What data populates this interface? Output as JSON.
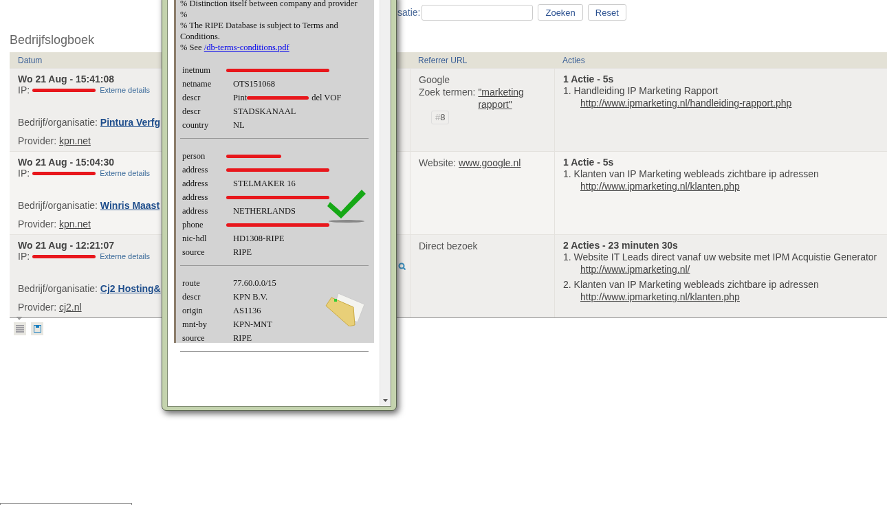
{
  "search": {
    "label": "satie:",
    "buttons": [
      "Zoeken",
      "Reset"
    ]
  },
  "title": "Bedrijfslogboek",
  "table": {
    "columns": [
      "Datum",
      "Referrer URL",
      "Acties"
    ],
    "rows": [
      {
        "date": "Wo 21 Aug - 15:41:08",
        "ip_label": "IP:",
        "external": "Externe details",
        "company_label": "Bedrijf/organisatie:",
        "company": "Pintura Verfg",
        "provider_label": "Provider:",
        "provider": "kpn.net",
        "zoom_icon": false,
        "referrer": {
          "kind": "search",
          "source": "Google",
          "terms_label": "Zoek termen:",
          "terms": "\"marketing rapport\"",
          "hash": "#",
          "count": "8"
        },
        "actions": {
          "summary": "1 Actie - 5s",
          "items": [
            {
              "number": "1.",
              "title": "Handleiding IP Marketing Rapport",
              "url": "http://www.ipmarketing.nl/handleiding-rapport.php"
            }
          ]
        }
      },
      {
        "date": "Wo 21 Aug - 15:04:30",
        "ip_label": "IP:",
        "external": "Externe details",
        "company_label": "Bedrijf/organisatie:",
        "company": "Winris Maast",
        "provider_label": "Provider:",
        "provider": "kpn.net",
        "zoom_icon": false,
        "referrer": {
          "kind": "website",
          "label": "Website:",
          "url": "www.google.nl"
        },
        "actions": {
          "summary": "1 Actie - 5s",
          "items": [
            {
              "number": "1.",
              "title": "Klanten van IP Marketing webleads zichtbare ip adressen",
              "url": "http://www.ipmarketing.nl/klanten.php"
            }
          ]
        }
      },
      {
        "date": "Wo 21 Aug - 12:21:07",
        "ip_label": "IP:",
        "external": "Externe details",
        "company_label": "Bedrijf/organisatie:",
        "company": "Cj2 Hosting&",
        "provider_label": "Provider:",
        "provider": "cj2.nl",
        "zoom_icon": true,
        "referrer": {
          "kind": "direct",
          "text": "Direct bezoek"
        },
        "actions": {
          "summary": "2 Acties - 23 minuten 30s",
          "items": [
            {
              "number": "1.",
              "title": "Website IT Leads direct vanaf uw website met IPM Acquistie Generator",
              "url": "http://www.ipmarketing.nl/"
            },
            {
              "number": "2.",
              "title": "Klanten van IP Marketing webleads zichtbare ip adressen",
              "url": "http://www.ipmarketing.nl/klanten.php"
            }
          ]
        }
      }
    ]
  },
  "whois_popup": {
    "notice": [
      "% Distinction itself between company and provider",
      "%",
      "% The RIPE Database is subject to Terms and Conditions."
    ],
    "see_prefix": "% See",
    "see_link": "/db-terms-conditions.pdf",
    "sections": [
      {
        "fields": [
          {
            "key": "inetnum",
            "redacted": true
          },
          {
            "key": "netname",
            "value": "OTS151068",
            "redacted": false
          },
          {
            "key": "descr",
            "head": "Pint",
            "value": "del VOF",
            "redacted": true
          },
          {
            "key": "descr",
            "value": "STADSKANAAL",
            "redacted": false
          },
          {
            "key": "country",
            "value": "NL",
            "redacted": false
          }
        ]
      },
      {
        "fields": [
          {
            "key": "person",
            "redacted": true
          },
          {
            "key": "address",
            "redacted": true
          },
          {
            "key": "address",
            "value": "STELMAKER 16",
            "redacted": false
          },
          {
            "key": "address",
            "redacted": true
          },
          {
            "key": "address",
            "value": "NETHERLANDS",
            "redacted": false
          },
          {
            "key": "phone",
            "redacted": true
          },
          {
            "key": "nic-hdl",
            "value": "HD1308-RIPE",
            "redacted": false
          },
          {
            "key": "source",
            "value": "RIPE",
            "redacted": false
          }
        ]
      },
      {
        "fields": [
          {
            "key": "route",
            "value": "77.60.0.0/15",
            "redacted": false
          },
          {
            "key": "descr",
            "value": "KPN B.V.",
            "redacted": false
          },
          {
            "key": "origin",
            "value": "AS1136",
            "redacted": false
          },
          {
            "key": "mnt-by",
            "value": "KPN-MNT",
            "redacted": false
          },
          {
            "key": "source",
            "value": "RIPE",
            "redacted": false
          }
        ]
      }
    ]
  }
}
